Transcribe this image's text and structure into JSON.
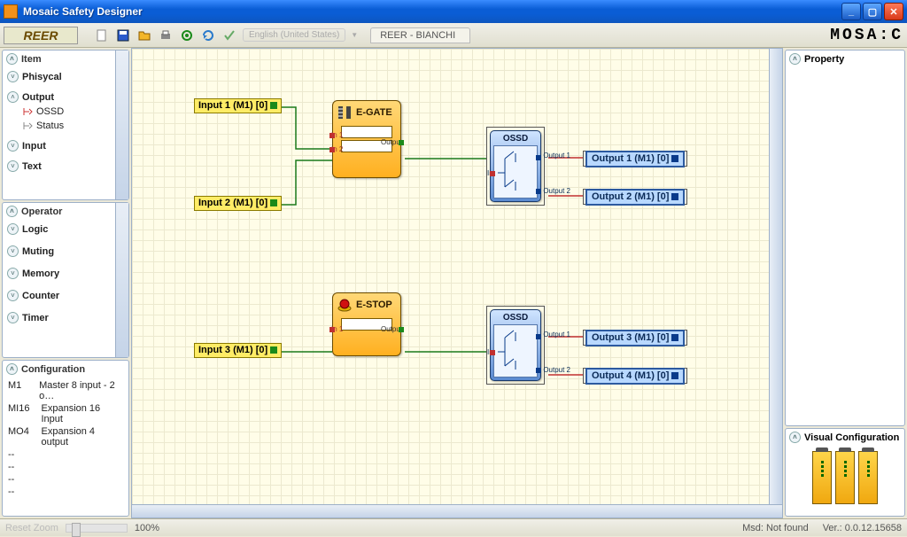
{
  "window": {
    "title": "Mosaic Safety Designer"
  },
  "toolbar": {
    "logo": "REER",
    "language": "English (United States)",
    "project_tab": "REER - BIANCHI",
    "brand": "MOSA:C"
  },
  "left": {
    "item_panel": {
      "title": "Item",
      "phisycal": "Phisycal",
      "output": "Output",
      "ossd": "OSSD",
      "status": "Status",
      "input": "Input",
      "text": "Text"
    },
    "operator_panel": {
      "title": "Operator",
      "logic": "Logic",
      "muting": "Muting",
      "memory": "Memory",
      "counter": "Counter",
      "timer": "Timer"
    },
    "config_panel": {
      "title": "Configuration",
      "rows": [
        {
          "k": "M1",
          "v": "Master 8 input - 2 o…"
        },
        {
          "k": "MI16",
          "v": "Expansion 16 Input"
        },
        {
          "k": "MO4",
          "v": "Expansion 4 output"
        },
        {
          "k": "--",
          "v": ""
        },
        {
          "k": "--",
          "v": ""
        },
        {
          "k": "--",
          "v": ""
        },
        {
          "k": "--",
          "v": ""
        }
      ]
    }
  },
  "right": {
    "property": "Property",
    "visual_cfg": "Visual Configuration"
  },
  "status": {
    "reset_zoom": "Reset Zoom",
    "zoom_pct": "100%",
    "msd": "Msd: Not found",
    "ver": "Ver.: 0.0.12.15658"
  },
  "canvas": {
    "inputs": {
      "in1": "Input 1 (M1) [0]",
      "in2": "Input 2 (M1) [0]",
      "in3": "Input 3 (M1) [0]"
    },
    "blocks": {
      "egate": {
        "title": "E-GATE",
        "pin1": "In 1",
        "pin2": "In 2",
        "out": "Output"
      },
      "estop": {
        "title": "E-STOP",
        "pin1": "In 1",
        "out": "Output"
      },
      "ossd": {
        "title": "OSSD",
        "in": "In",
        "o1": "Output 1",
        "o2": "Output 2"
      }
    },
    "outputs": {
      "o1": "Output 1 (M1) [0]",
      "o2": "Output 2 (M1) [0]",
      "o3": "Output 3 (M1) [0]",
      "o4": "Output 4 (M1) [0]"
    }
  }
}
